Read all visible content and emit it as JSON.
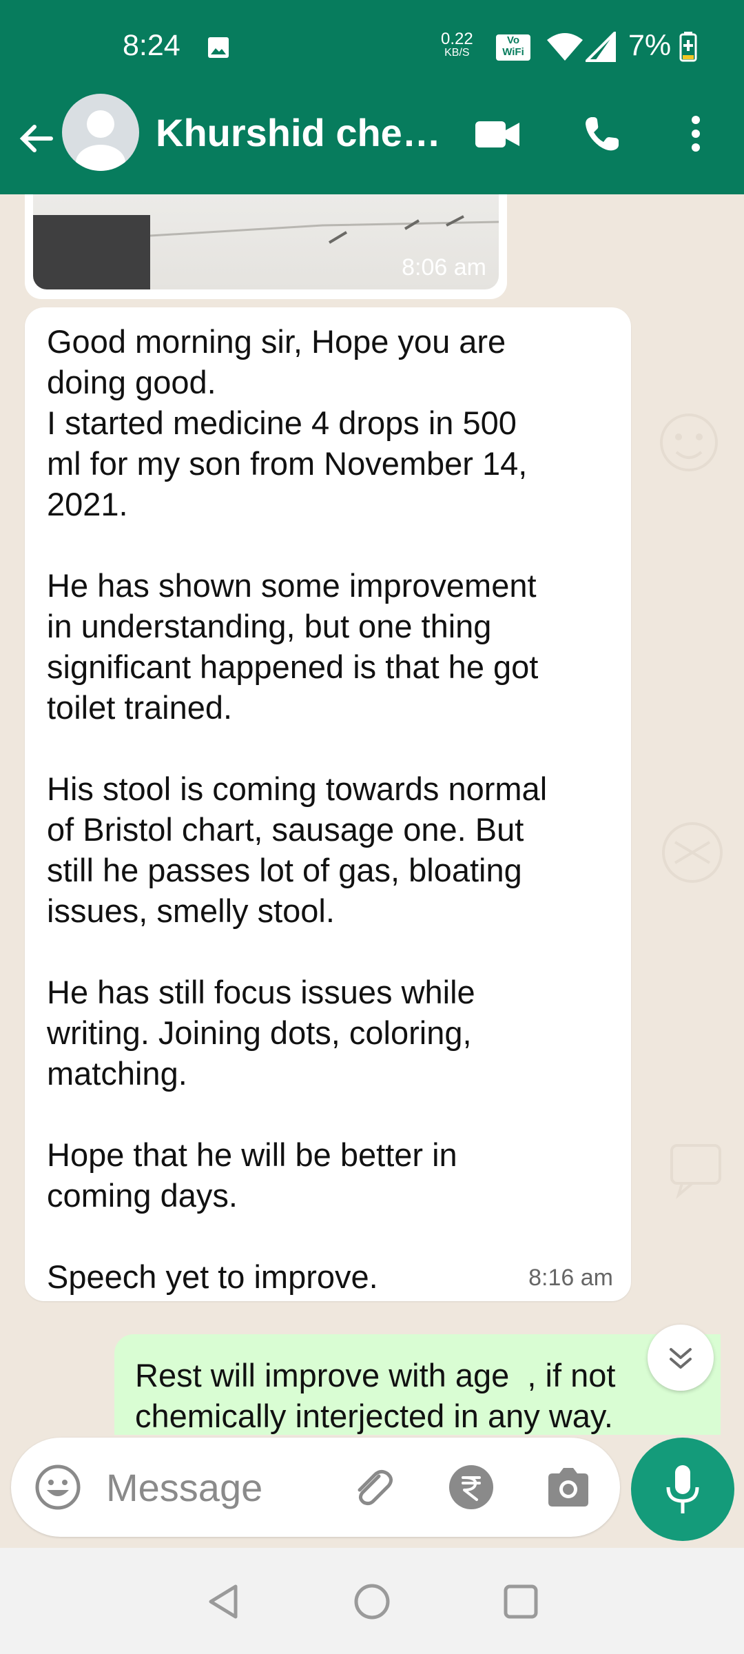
{
  "status_bar": {
    "time": "8:24",
    "net_speed": "0.22",
    "net_unit": "KB/S",
    "vowifi_top": "Vo",
    "vowifi_bottom": "WiFi",
    "battery": "7%"
  },
  "header": {
    "contact_name": "Khurshid chen…"
  },
  "messages": [
    {
      "type": "image",
      "time": "8:06 am"
    },
    {
      "type": "received",
      "text": "Good morning sir, Hope you are\ndoing good.\nI started medicine 4 drops in 500\nml for my son from November 14,\n2021.\n\nHe has shown some improvement\nin understanding, but one thing\nsignificant happened is that he got\ntoilet trained.\n\nHis stool is coming towards normal\nof Bristol chart, sausage one. But\nstill he passes lot of gas, bloating\nissues, smelly stool.\n\nHe has still focus issues while\nwriting. Joining dots, coloring,\nmatching.\n\nHope that he will be better in\ncoming days.\n\nSpeech yet to improve.",
      "time": "8:16 am"
    },
    {
      "type": "sent",
      "text": "Rest will improve with age  , if not\nchemically interjected in any way."
    }
  ],
  "composer": {
    "placeholder": "Message"
  },
  "colors": {
    "header_green": "#077c5d",
    "mic_green": "#149b7a",
    "chat_bg": "#efe7dd",
    "sent_bubble": "#d9fdd3"
  },
  "icons": [
    "back-arrow-icon",
    "avatar-icon",
    "video-call-icon",
    "phone-icon",
    "more-vert-icon",
    "emoji-icon",
    "attach-icon",
    "rupee-icon",
    "camera-icon",
    "mic-icon",
    "scroll-down-icon"
  ]
}
